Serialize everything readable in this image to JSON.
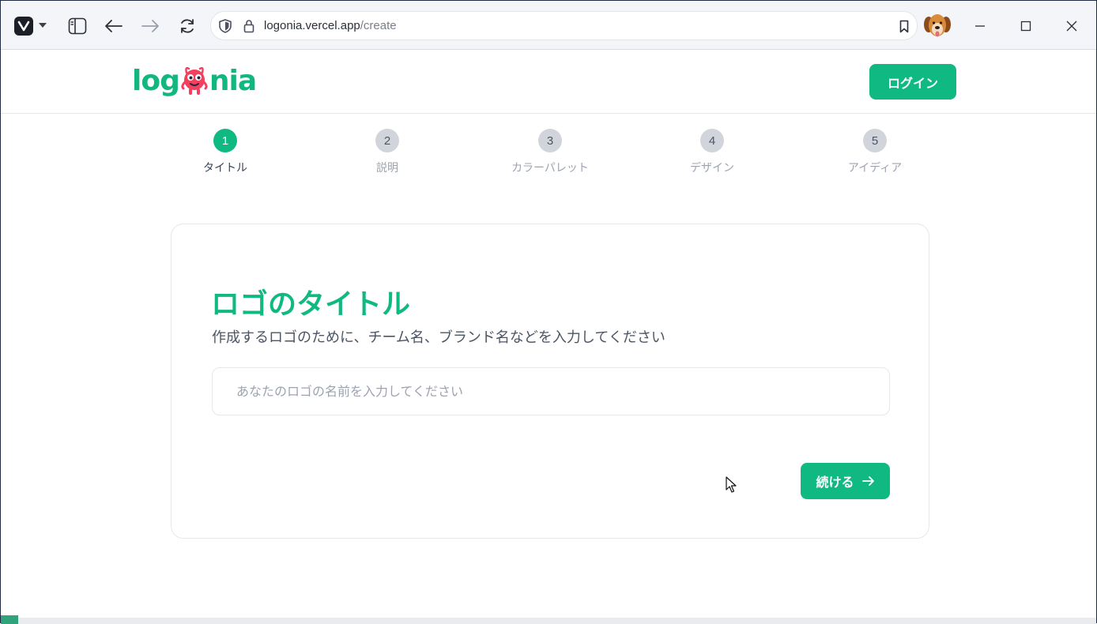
{
  "browser": {
    "url_host": "logonia.vercel.app",
    "url_path": "/create",
    "icons": [
      "vivaldi-logo-icon",
      "panel-toggle-icon",
      "back-arrow-icon",
      "forward-arrow-icon",
      "reload-icon",
      "shield-icon",
      "lock-icon",
      "bookmark-icon",
      "minimize-icon",
      "maximize-icon",
      "close-icon"
    ]
  },
  "header": {
    "logo_left": "log",
    "logo_right": "nia",
    "login_label": "ログイン"
  },
  "stepper": {
    "active_step": 1,
    "steps": [
      {
        "number": "1",
        "label": "タイトル"
      },
      {
        "number": "2",
        "label": "説明"
      },
      {
        "number": "3",
        "label": "カラーパレット"
      },
      {
        "number": "4",
        "label": "デザイン"
      },
      {
        "number": "5",
        "label": "アイディア"
      }
    ]
  },
  "form": {
    "title": "ロゴのタイトル",
    "subtitle": "作成するロゴのために、チーム名、ブランド名などを入力してください",
    "input_value": "",
    "input_placeholder": "あなたのロゴの名前を入力してください",
    "continue_label": "続ける"
  },
  "colors": {
    "accent": "#10b981",
    "step_inactive": "#d1d5db",
    "mascot": "#f43f5e"
  }
}
